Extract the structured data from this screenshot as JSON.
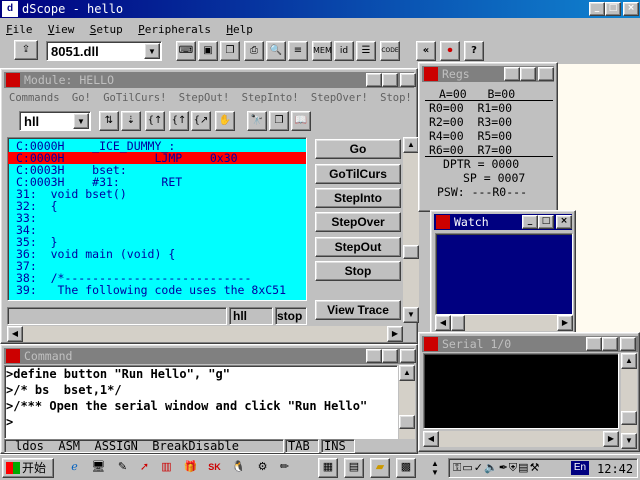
{
  "app": {
    "title": "dScope - hello",
    "min": "_",
    "max": "□",
    "close": "×"
  },
  "menu": [
    {
      "u": "F",
      "rest": "ile"
    },
    {
      "u": "V",
      "rest": "iew"
    },
    {
      "u": "S",
      "rest": "etup"
    },
    {
      "u": "P",
      "rest": "eripherals"
    },
    {
      "u": "H",
      "rest": "elp"
    }
  ],
  "toolbar": {
    "dll_value": "8051.dll",
    "open_glyph": "⇪",
    "help_glyph": "?",
    "stop_glyph": "⏺",
    "back_glyph": "«",
    "code_label": "CODE"
  },
  "module": {
    "title": "Module: HELLO",
    "menu": [
      "Commands",
      "Go!",
      "GoTilCurs!",
      "StepOut!",
      "StepInto!",
      "StepOver!",
      "Stop!"
    ],
    "select_value": "hll",
    "code_lines": [
      "C:0000H    _ICE_DUMMY_:",
      "C:0000H             LJMP    0x30",
      "C:0003H    bset:",
      "C:0003H    #31:      RET",
      "31:  void bset()",
      "32:  {",
      "33:",
      "34:",
      "35:  }",
      "36:  void main (void) {",
      "37:",
      "38:  /*---------------------------",
      "39:   The following code uses the 8xC51"
    ],
    "buttons": [
      "Go",
      "GoTilCurs",
      "StepInto",
      "StepOver",
      "StepOut",
      "Stop",
      "View Trace"
    ],
    "status_mode": "hll",
    "status_state": "stop"
  },
  "regs": {
    "title": "Regs",
    "rows": [
      "A=00   B=00",
      "R0=00  R1=00",
      "R2=00  R3=00",
      "R4=00  R5=00",
      "R6=00  R7=00"
    ],
    "dptr": "DPTR = 0000",
    "sp": "SP = 0007",
    "psw": "PSW: ---R0---"
  },
  "watch": {
    "title": "Watch"
  },
  "serial": {
    "title": "Serial 1/0"
  },
  "command": {
    "title": "Command",
    "lines": [
      ">define button \"Run Hello\", \"g\"",
      ">/* bs  bset,1*/",
      ">/*** Open the serial window and click \"Run Hello\"",
      ">"
    ],
    "status": "ldos  ASM  ASSIGN  BreakDisable",
    "tab": "TAB",
    "ins": "INS"
  },
  "taskbar": {
    "start_label": "开始",
    "clock": "12:42",
    "lang": "En"
  },
  "colors": {
    "code_bg": "#00ffff",
    "highlight": "#ff0000",
    "title_active": "#000080",
    "title_inactive": "#808080",
    "watch_bg": "#000080",
    "serial_bg": "#000000"
  }
}
